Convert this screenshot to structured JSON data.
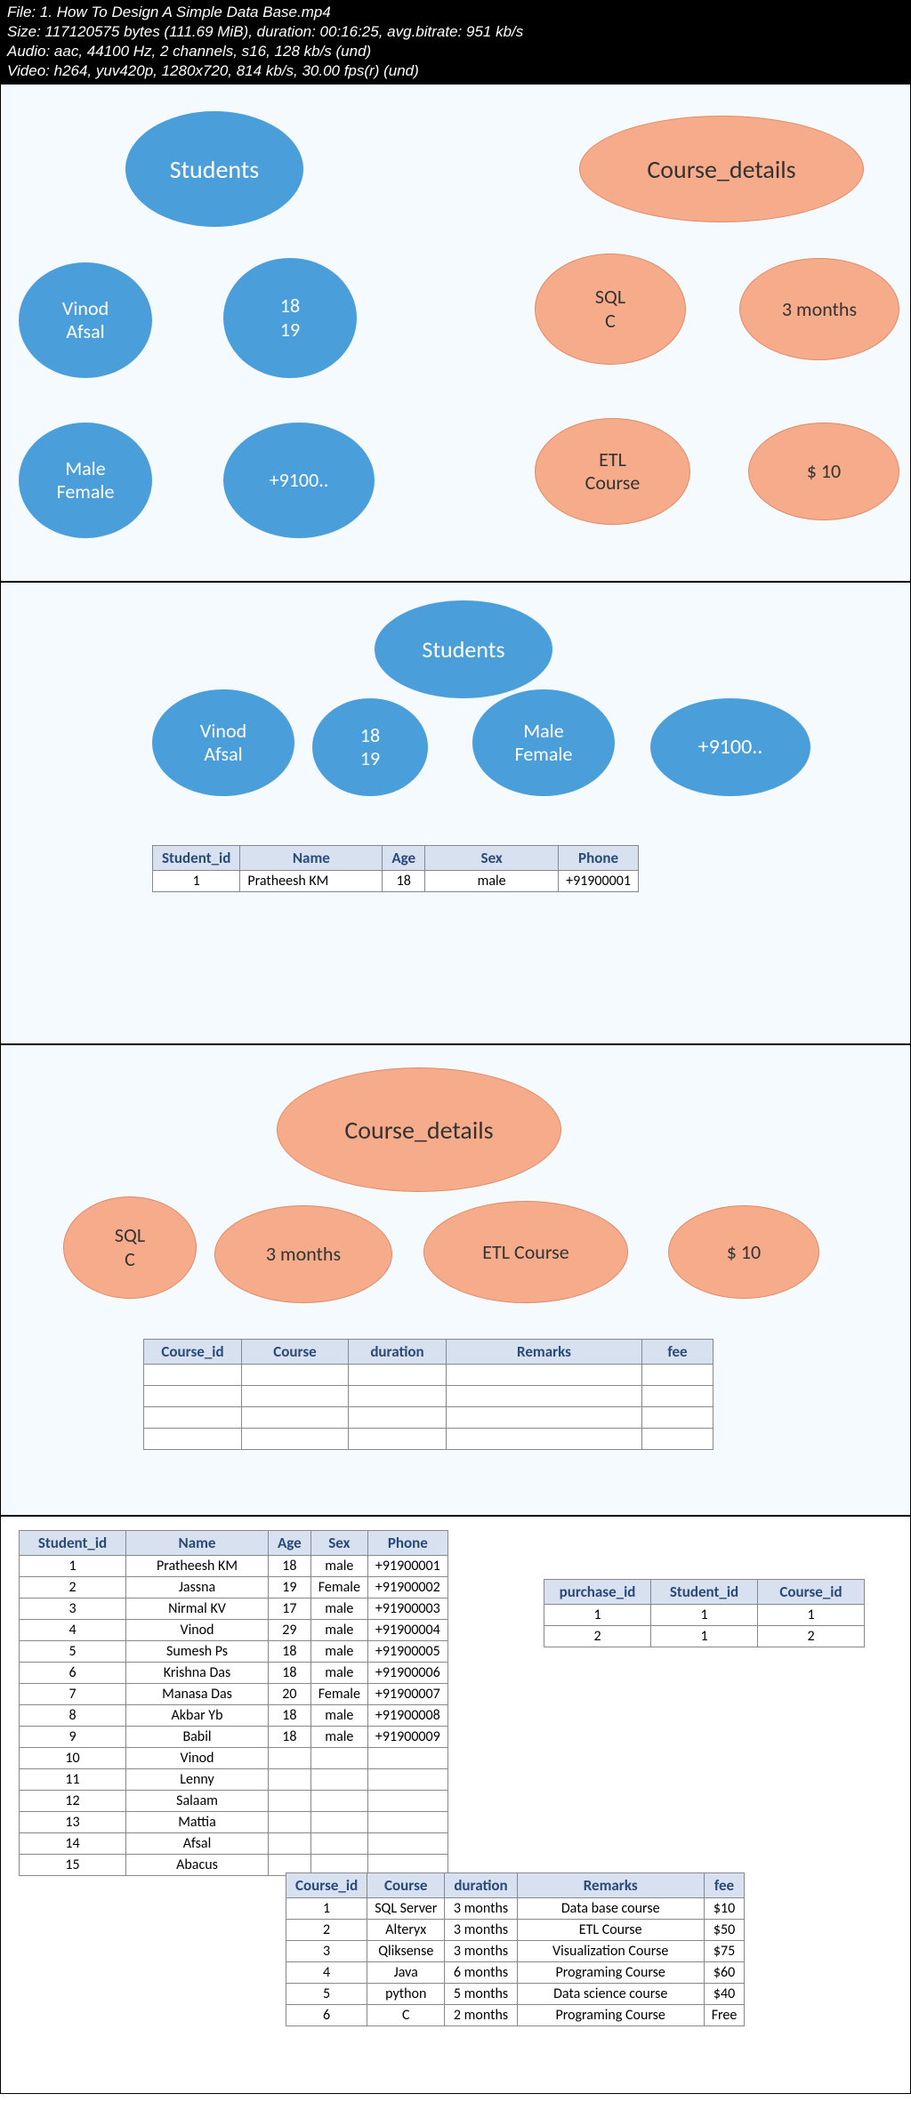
{
  "header": {
    "file": "File: 1. How To Design A Simple Data Base.mp4",
    "size": "Size: 117120575 bytes (111.69 MiB), duration: 00:16:25, avg.bitrate: 951 kb/s",
    "audio": "Audio: aac, 44100 Hz, 2 channels, s16, 128 kb/s (und)",
    "video": "Video: h264, yuv420p, 1280x720, 814 kb/s, 30.00 fps(r) (und)"
  },
  "p1": {
    "blue": {
      "a": "Students",
      "b": "Vinod\nAfsal",
      "c": "18\n19",
      "d": "Male\nFemale",
      "e": "+9100.."
    },
    "peach": {
      "a": "Course_details",
      "b": "SQL\nC",
      "c": "3 months",
      "d": "ETL\nCourse",
      "e": "$ 10"
    }
  },
  "p2": {
    "bubbles": {
      "a": "Students",
      "b": "Vinod\nAfsal",
      "c": "18\n19",
      "d": "Male\nFemale",
      "e": "+9100.."
    },
    "table": {
      "headers": [
        "Student_id",
        "Name",
        "Age",
        "Sex",
        "Phone"
      ],
      "rows": [
        [
          "1",
          "Pratheesh KM",
          "18",
          "male",
          "+91900001"
        ]
      ]
    }
  },
  "p3": {
    "bubbles": {
      "a": "Course_details",
      "b": "SQL\nC",
      "c": "3 months",
      "d": "ETL Course",
      "e": "$ 10"
    },
    "table": {
      "headers": [
        "Course_id",
        "Course",
        "duration",
        "Remarks",
        "fee"
      ],
      "rows": [
        [
          "",
          "",
          "",
          "",
          ""
        ],
        [
          "",
          "",
          "",
          "",
          ""
        ],
        [
          "",
          "",
          "",
          "",
          ""
        ],
        [
          "",
          "",
          "",
          "",
          ""
        ]
      ]
    }
  },
  "p4": {
    "students": {
      "headers": [
        "Student_id",
        "Name",
        "Age",
        "Sex",
        "Phone"
      ],
      "rows": [
        [
          "1",
          "Pratheesh KM",
          "18",
          "male",
          "+91900001"
        ],
        [
          "2",
          "Jassna",
          "19",
          "Female",
          "+91900002"
        ],
        [
          "3",
          "Nirmal KV",
          "17",
          "male",
          "+91900003"
        ],
        [
          "4",
          "Vinod",
          "29",
          "male",
          "+91900004"
        ],
        [
          "5",
          "Sumesh Ps",
          "18",
          "male",
          "+91900005"
        ],
        [
          "6",
          "Krishna Das",
          "18",
          "male",
          "+91900006"
        ],
        [
          "7",
          "Manasa Das",
          "20",
          "Female",
          "+91900007"
        ],
        [
          "8",
          "Akbar Yb",
          "18",
          "male",
          "+91900008"
        ],
        [
          "9",
          "Babil",
          "18",
          "male",
          "+91900009"
        ],
        [
          "10",
          "Vinod",
          "",
          "",
          ""
        ],
        [
          "11",
          "Lenny",
          "",
          "",
          ""
        ],
        [
          "12",
          "Salaam",
          "",
          "",
          ""
        ],
        [
          "13",
          "Mattia",
          "",
          "",
          ""
        ],
        [
          "14",
          "Afsal",
          "",
          "",
          ""
        ],
        [
          "15",
          "Abacus",
          "",
          "",
          ""
        ]
      ]
    },
    "purchases": {
      "headers": [
        "purchase_id",
        "Student_id",
        "Course_id"
      ],
      "rows": [
        [
          "1",
          "1",
          "1"
        ],
        [
          "2",
          "1",
          "2"
        ]
      ]
    },
    "courses": {
      "headers": [
        "Course_id",
        "Course",
        "duration",
        "Remarks",
        "fee"
      ],
      "rows": [
        [
          "1",
          "SQL Server",
          "3 months",
          "Data base course",
          "$10"
        ],
        [
          "2",
          "Alteryx",
          "3 months",
          "ETL Course",
          "$50"
        ],
        [
          "3",
          "Qliksense",
          "3 months",
          "Visualization Course",
          "$75"
        ],
        [
          "4",
          "Java",
          "6 months",
          "Programing Course",
          "$60"
        ],
        [
          "5",
          "python",
          "5 months",
          "Data science course",
          "$40"
        ],
        [
          "6",
          "C",
          "2 months",
          "Programing Course",
          "Free"
        ]
      ]
    }
  }
}
